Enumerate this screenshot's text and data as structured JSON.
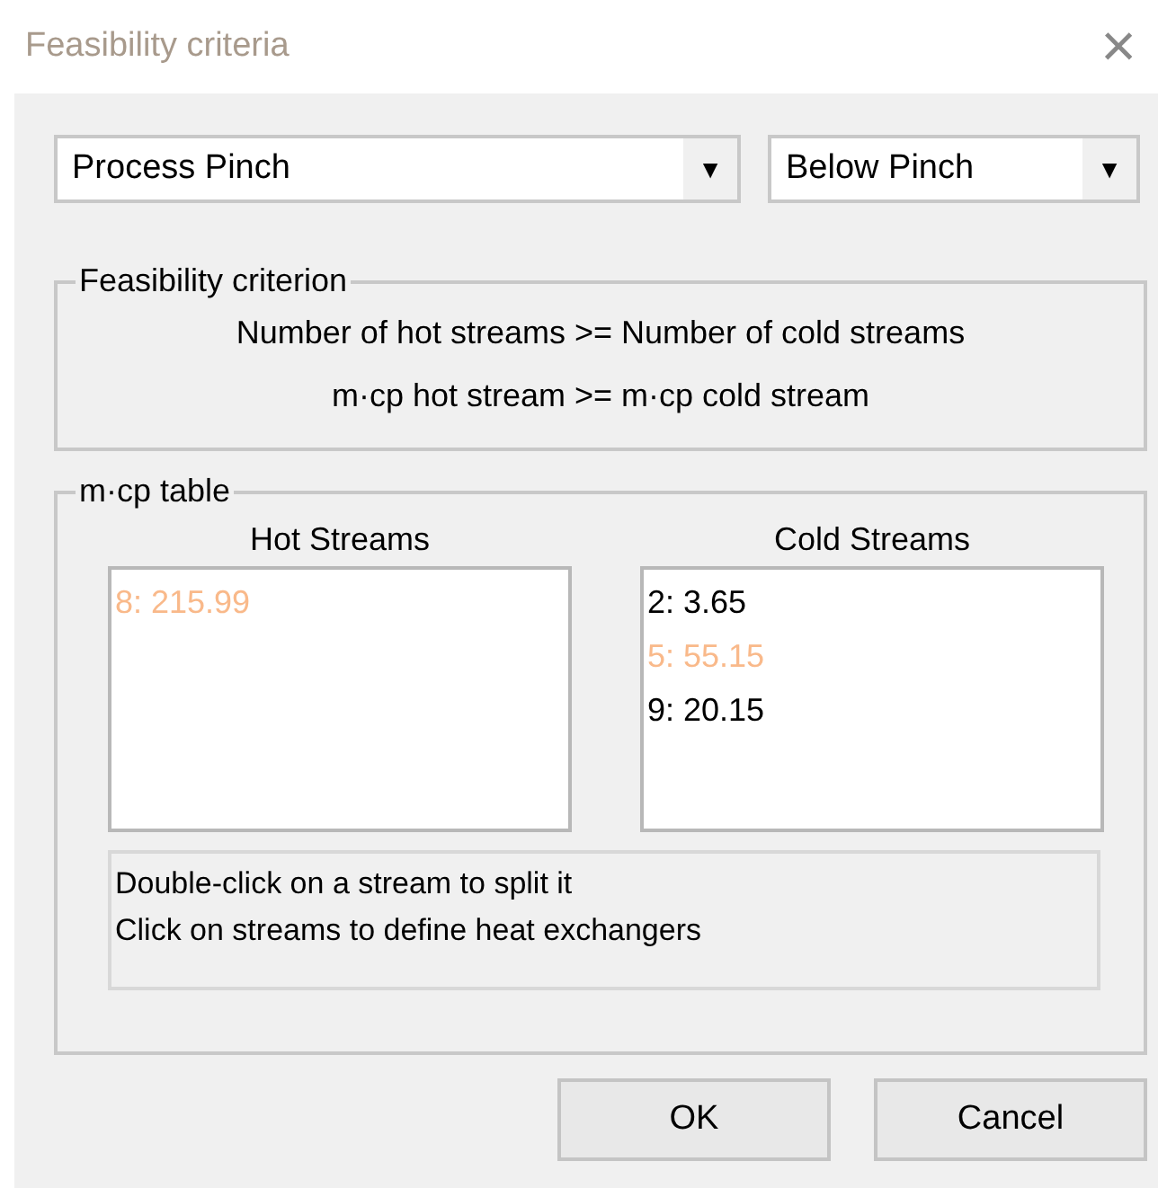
{
  "window": {
    "title": "Feasibility criteria",
    "close": "×"
  },
  "dropdowns": [
    {
      "value": "Process Pinch",
      "arrow": "▼"
    },
    {
      "value": "Below Pinch",
      "arrow": "▼"
    }
  ],
  "criterion_group": {
    "title": "Feasibility criterion",
    "lines": [
      "Number of hot streams >= Number of cold streams",
      "m·cp hot stream >= m·cp cold stream"
    ]
  },
  "table_group": {
    "title": "m·cp table",
    "lists": [
      {
        "heading": "Hot Streams",
        "items": [
          {
            "text": "8: 215.99",
            "color": "#f9b98a"
          }
        ]
      },
      {
        "heading": "Cold Streams",
        "items": [
          {
            "text": "2: 3.65",
            "color": "#000000"
          },
          {
            "text": "5: 55.15",
            "color": "#f9b98a"
          },
          {
            "text": "9: 20.15",
            "color": "#000000"
          }
        ]
      }
    ],
    "message": [
      "Double-click on a stream to split it",
      "Click on streams to define heat exchangers"
    ]
  },
  "buttons": [
    "OK",
    "Cancel"
  ]
}
